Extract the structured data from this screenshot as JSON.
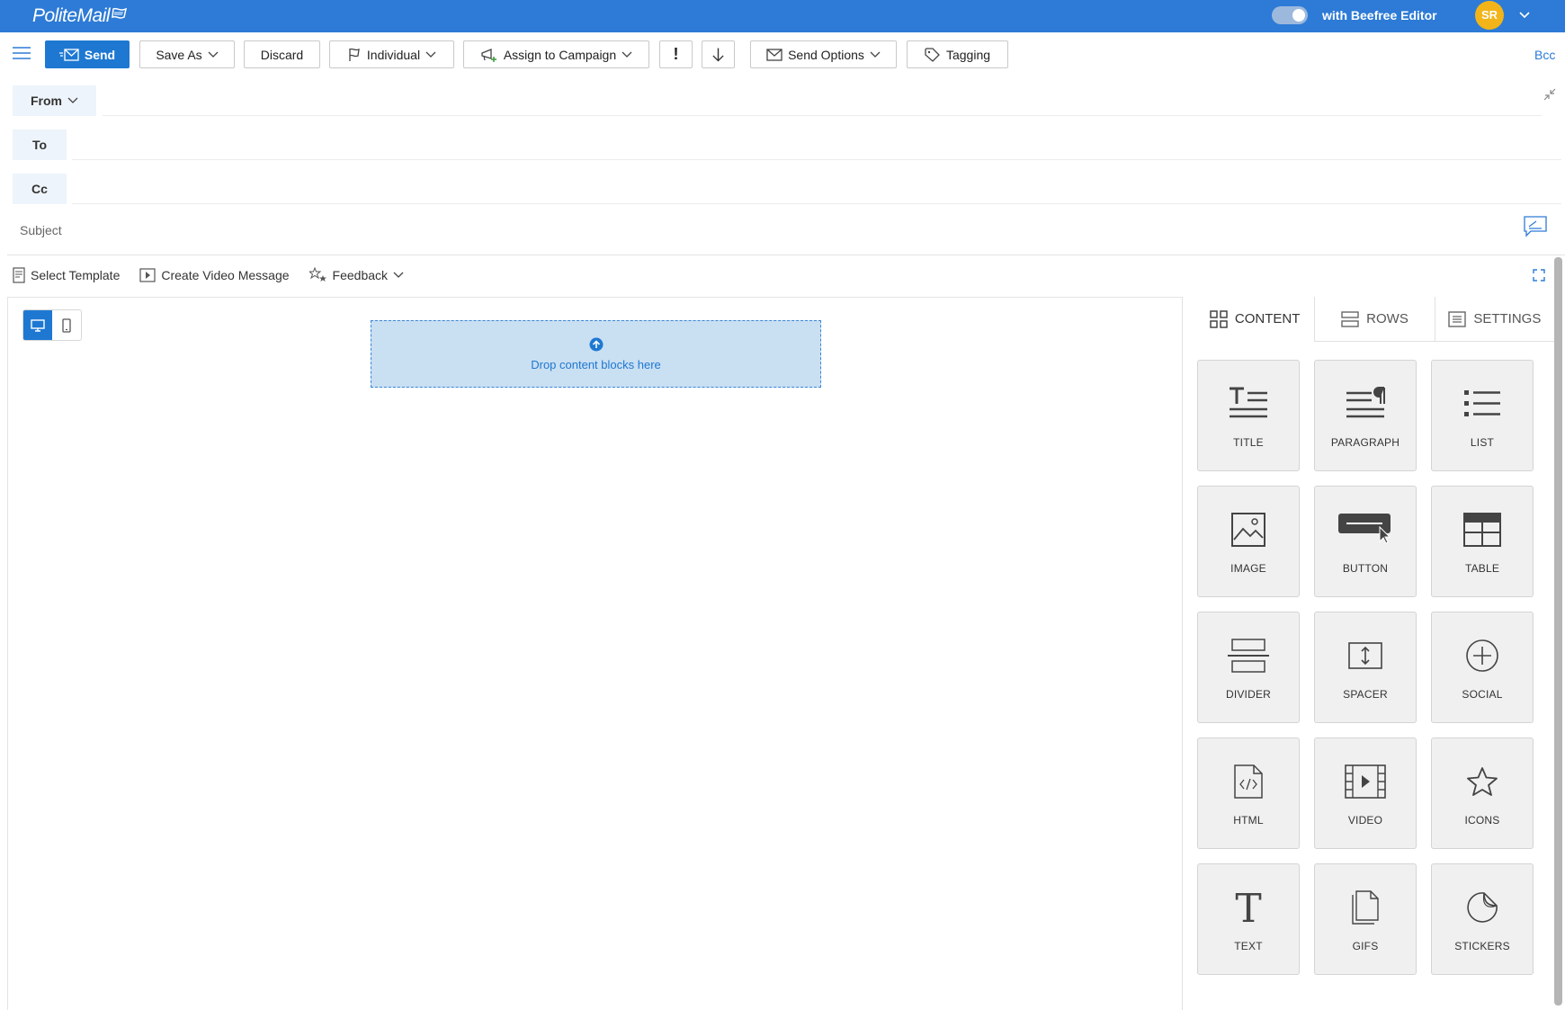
{
  "app": {
    "brand": "PoliteMail",
    "editor_label": "with Beefree Editor",
    "user_initials": "SR"
  },
  "toolbar": {
    "send": "Send",
    "save_as": "Save As",
    "discard": "Discard",
    "individual": "Individual",
    "assign_campaign": "Assign to Campaign",
    "important": "!",
    "send_options": "Send Options",
    "tagging": "Tagging",
    "bcc": "Bcc"
  },
  "fields": {
    "from": "From",
    "to": "To",
    "cc": "Cc",
    "subject_placeholder": "Subject"
  },
  "editor_tools": {
    "select_template": "Select Template",
    "create_video": "Create Video Message",
    "feedback": "Feedback"
  },
  "canvas": {
    "drop_text": "Drop content blocks here"
  },
  "panel": {
    "tabs": [
      {
        "label": "CONTENT"
      },
      {
        "label": "ROWS"
      },
      {
        "label": "SETTINGS"
      }
    ],
    "blocks": [
      {
        "label": "TITLE",
        "icon": "title-icon"
      },
      {
        "label": "PARAGRAPH",
        "icon": "paragraph-icon"
      },
      {
        "label": "LIST",
        "icon": "list-icon"
      },
      {
        "label": "IMAGE",
        "icon": "image-icon"
      },
      {
        "label": "BUTTON",
        "icon": "button-icon"
      },
      {
        "label": "TABLE",
        "icon": "table-icon"
      },
      {
        "label": "DIVIDER",
        "icon": "divider-icon"
      },
      {
        "label": "SPACER",
        "icon": "spacer-icon"
      },
      {
        "label": "SOCIAL",
        "icon": "social-icon"
      },
      {
        "label": "HTML",
        "icon": "html-icon"
      },
      {
        "label": "VIDEO",
        "icon": "video-icon"
      },
      {
        "label": "ICONS",
        "icon": "star-icon"
      },
      {
        "label": "TEXT",
        "icon": "text-icon"
      },
      {
        "label": "GIFS",
        "icon": "gifs-icon"
      },
      {
        "label": "STICKERS",
        "icon": "sticker-icon"
      }
    ]
  },
  "colors": {
    "topbar": "#2d7bd6",
    "primary": "#1e78d2",
    "dropzone": "#c9dff2",
    "avatar": "#f2b418"
  }
}
